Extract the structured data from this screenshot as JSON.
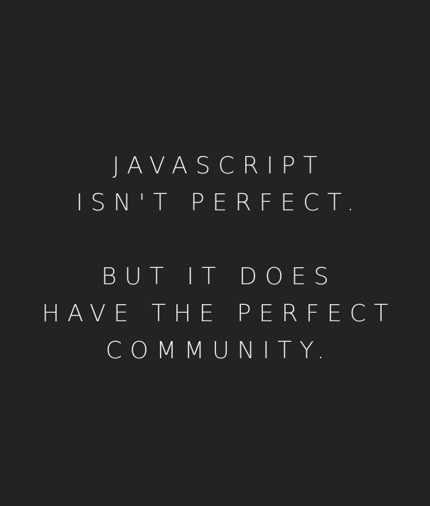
{
  "quote": {
    "first_block": [
      "JAVASCRIPT",
      "ISN'T PERFECT."
    ],
    "second_block": [
      "BUT IT DOES",
      "HAVE THE PERFECT",
      "COMMUNITY."
    ]
  },
  "colors": {
    "background": "#232323",
    "text": "#f2f2f2"
  }
}
